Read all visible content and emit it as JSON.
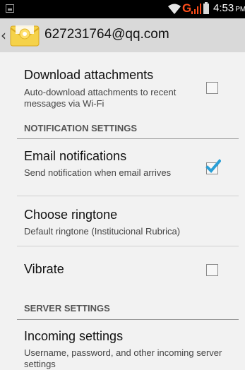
{
  "status_bar": {
    "time": "4:53",
    "ampm": "PM",
    "network": "G",
    "icons": [
      "notification-icon",
      "wifi-icon",
      "signal-icon",
      "battery-icon"
    ]
  },
  "app_bar": {
    "back_glyph": "‹",
    "account": "627231764@qq.com",
    "icon": "mail-icon"
  },
  "settings": {
    "download": {
      "title": "Download attachments",
      "summary": "Auto-download attachments to recent messages via Wi-Fi",
      "checked": false
    },
    "notification_header": "NOTIFICATION SETTINGS",
    "email_notifications": {
      "title": "Email notifications",
      "summary": "Send notification when email arrives",
      "checked": true
    },
    "ringtone": {
      "title": "Choose ringtone",
      "summary": "Default ringtone (Institucional Rubrica)"
    },
    "vibrate": {
      "title": "Vibrate",
      "checked": false
    },
    "server_header": "SERVER SETTINGS",
    "incoming": {
      "title": "Incoming settings",
      "summary": "Username, password, and other incoming server settings"
    }
  },
  "colors": {
    "accent_check": "#2a9fd6",
    "network_g": "#ff4d1a"
  }
}
